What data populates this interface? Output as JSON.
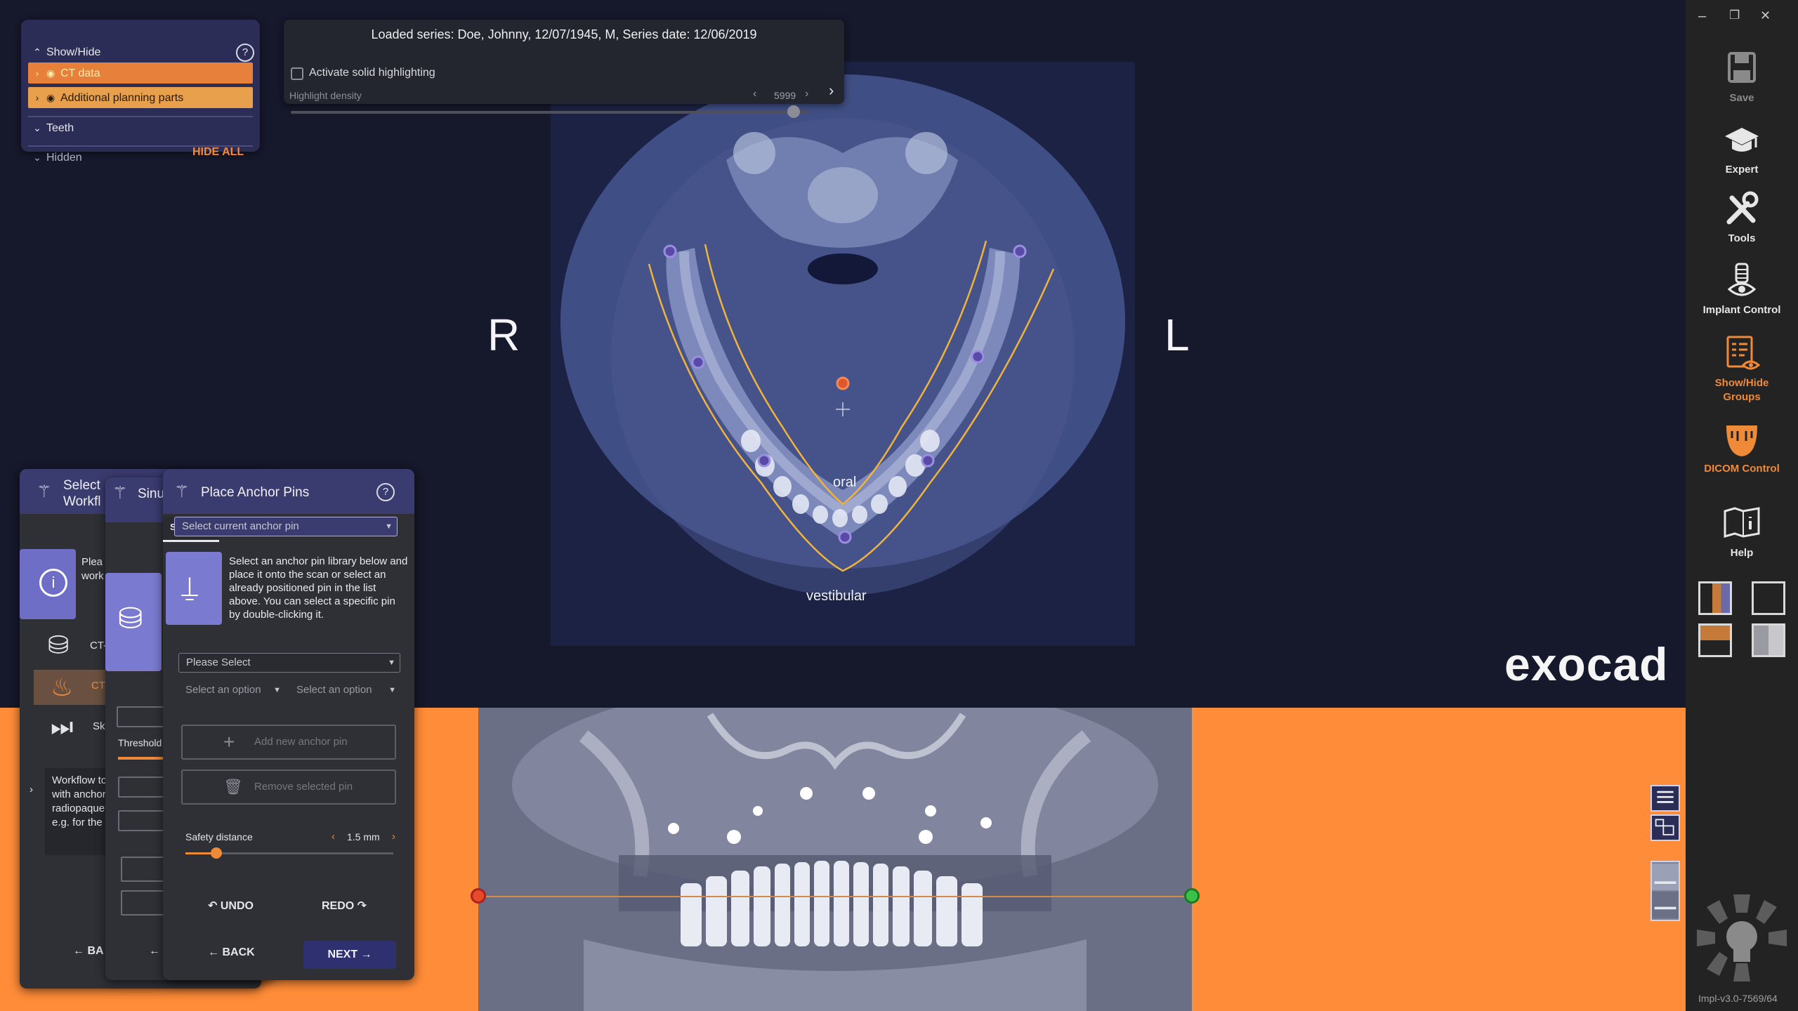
{
  "series": {
    "title": "Loaded series: Doe, Johnny, 12/07/1945, M, Series date: 12/06/2019",
    "solid_highlight_label": "Activate solid highlighting",
    "density_label": "Highlight density",
    "density_value": "5999",
    "density_fraction": 0.97
  },
  "show_hide": {
    "header": "Show/Hide",
    "ct_data": "CT data",
    "additional": "Additional planning parts",
    "teeth": "Teeth",
    "hidden": "Hidden",
    "hide_all": "HIDE ALL",
    "help": "?"
  },
  "viewport": {
    "right_label": "R",
    "left_label": "L",
    "oral": "oral",
    "vestibular": "vestibular",
    "brand": "exocad"
  },
  "toolbar": {
    "save": "Save",
    "expert": "Expert",
    "tools": "Tools",
    "implant_control": "Implant Control",
    "show_hide_groups_1": "Show/Hide",
    "show_hide_groups_2": "Groups",
    "dicom_control": "DICOM Control",
    "help": "Help",
    "minimize": "–",
    "restore": "❐",
    "close": "✕",
    "version": "Impl-v3.0-7569/64"
  },
  "workflow": {
    "back_tab_1a": "Select",
    "back_tab_1b": "Workfl",
    "back_tab_2": "Sinu",
    "front_tab": "Place Anchor Pins",
    "help": "?",
    "mode_tab": "SEMI-AUT",
    "anchor_dropdown": "Select current anchor pin",
    "instructions": "Select an anchor pin library below and place it onto the scan or select an already positioned pin in the list above. You can select a specific pin by double-clicking it.",
    "back_note_1a": "Plea",
    "back_note_1b": "work",
    "back_item_1": "CT-",
    "back_item_2": "CT",
    "back_item_3": "Ski",
    "back_desc": "Workflow to\nwith anchor\nradiopaque\ne.g. for the",
    "threshold": "Threshold",
    "please_select": "Please Select",
    "option_1": "Select an option",
    "option_2": "Select an option",
    "add_pin": "Add new anchor pin",
    "remove_pin": "Remove selected pin",
    "safety_label": "Safety distance",
    "safety_value": "1.5 mm",
    "safety_fraction": 0.15,
    "undo": "UNDO",
    "redo": "REDO",
    "back_1": "BA",
    "back_2": "B",
    "back": "BACK",
    "next": "NEXT"
  },
  "colors": {
    "accent_orange": "#ff8c38",
    "panel_purple": "#2c2d56",
    "curve_yellow": "#f0b43c",
    "pin_purple": "#5a4aa8"
  }
}
